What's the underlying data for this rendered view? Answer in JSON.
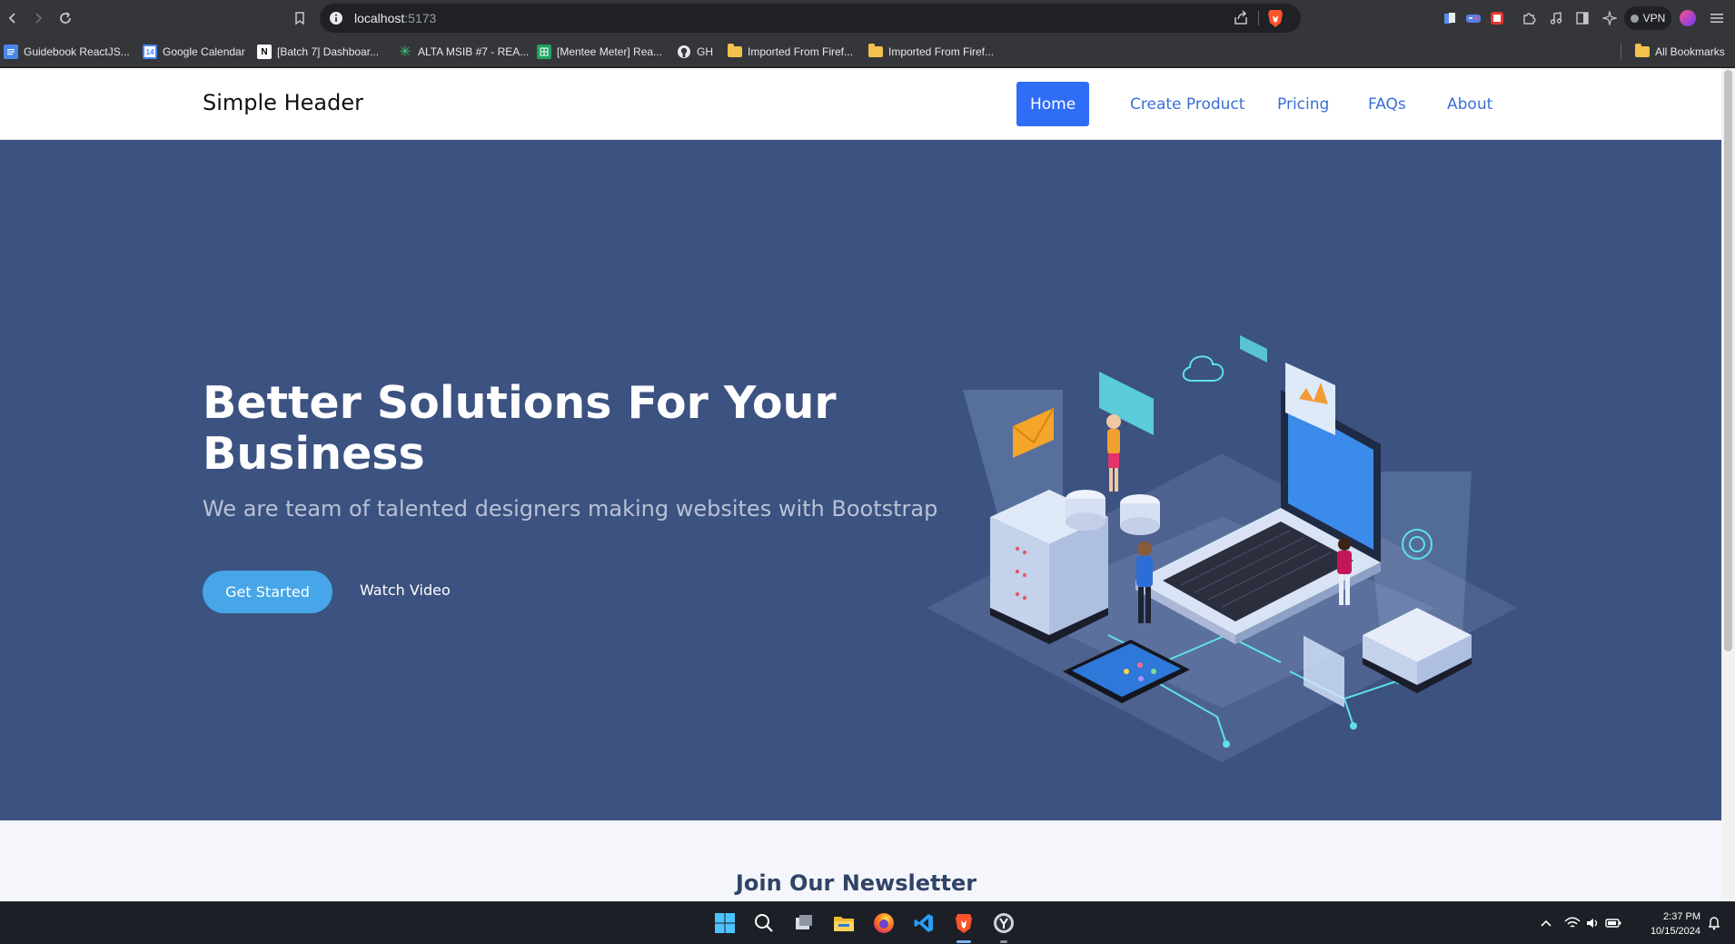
{
  "browser": {
    "url_host": "localhost",
    "url_path": ":5173",
    "vpn_label": "VPN",
    "all_bookmarks": "All Bookmarks",
    "bookmarks": [
      {
        "label": "Guidebook ReactJS..."
      },
      {
        "label": "Google Calendar"
      },
      {
        "label": "[Batch 7] Dashboar..."
      },
      {
        "label": "ALTA MSIB #7 - REA..."
      },
      {
        "label": "[Mentee Meter] Rea..."
      },
      {
        "label": "GH"
      },
      {
        "label": "Imported From Firef..."
      },
      {
        "label": "Imported From Firef..."
      }
    ]
  },
  "site": {
    "brand": "Simple Header",
    "nav": [
      {
        "label": "Home",
        "active": true
      },
      {
        "label": "Create Product"
      },
      {
        "label": "Pricing"
      },
      {
        "label": "FAQs"
      },
      {
        "label": "About"
      }
    ],
    "hero": {
      "title": "Better Solutions For Your Business",
      "subtitle": "We are team of talented designers making websites with Bootstrap",
      "cta_primary": "Get Started",
      "cta_secondary": "Watch Video"
    },
    "newsletter": {
      "title": "Join Our Newsletter"
    }
  },
  "taskbar": {
    "time": "2:37 PM",
    "date": "10/15/2024",
    "apps": [
      "start-icon",
      "search-icon",
      "task-view-icon",
      "file-explorer-icon",
      "firefox-icon",
      "vscode-icon",
      "brave-icon",
      "app-icon"
    ]
  },
  "colors": {
    "hero_bg": "#3c5280",
    "nav_active": "#2f6df6",
    "nav_link": "#3a6fd8",
    "cta": "#47a6e8",
    "newsletter_bg": "#f5f6fb"
  }
}
